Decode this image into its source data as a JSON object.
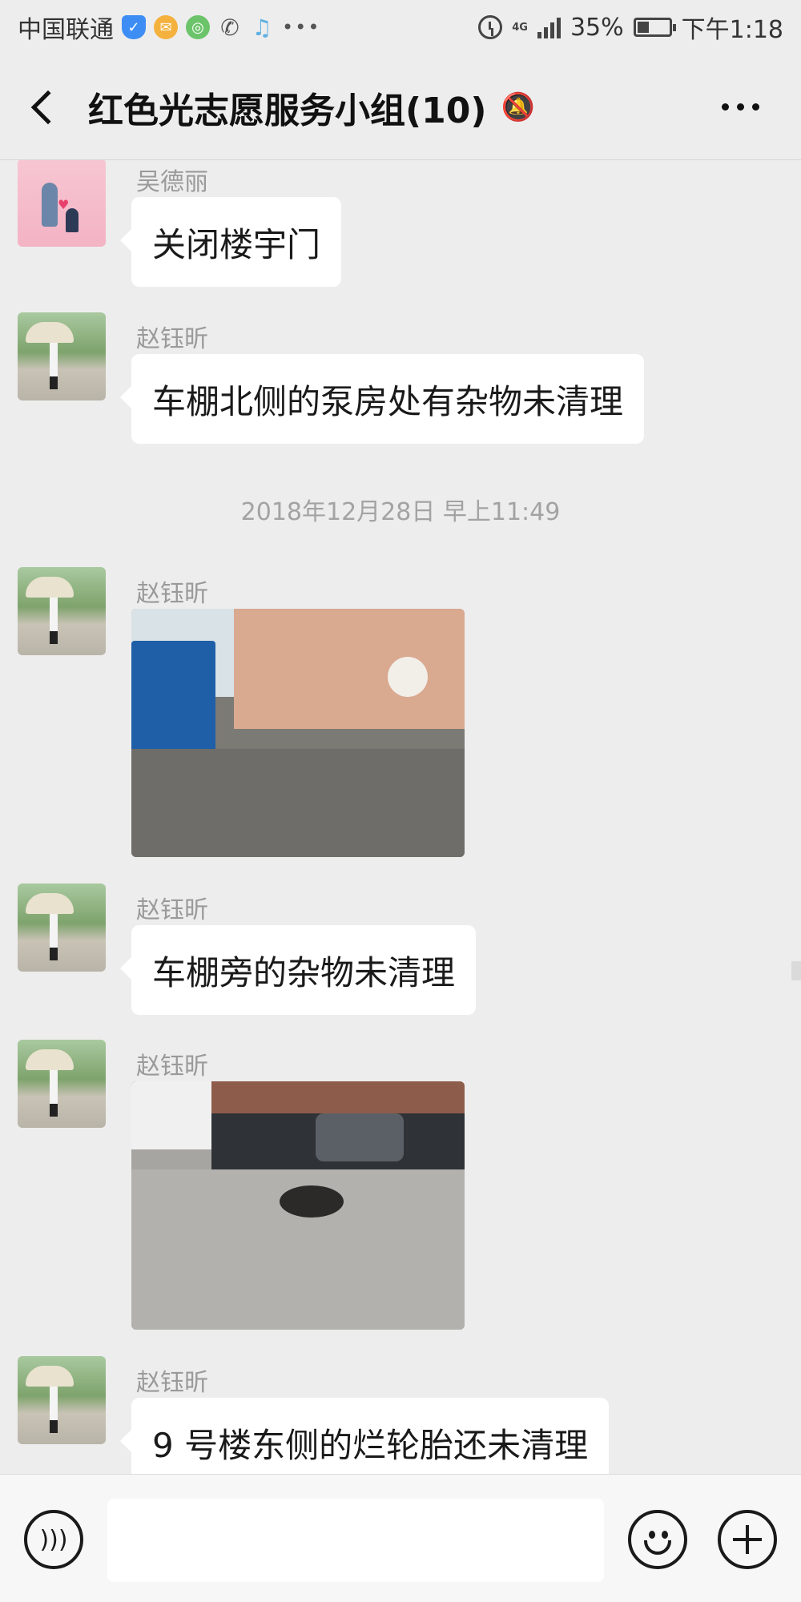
{
  "status_bar": {
    "carrier": "中国联通",
    "network": "4G",
    "battery": "35%",
    "time": "下午1:18",
    "icons": [
      "shield-icon",
      "mail-icon",
      "app-icon",
      "wechat-icon",
      "bell-icon",
      "more-dots-icon",
      "alarm-icon",
      "signal-icon",
      "battery-icon"
    ]
  },
  "header": {
    "title": "红色光志愿服务小组(10)",
    "muted": true
  },
  "messages": [
    {
      "type": "text",
      "sender": "吴德丽",
      "avatar": "pink-avatar",
      "text": "关闭楼宇门"
    },
    {
      "type": "text",
      "sender": "赵钰昕",
      "avatar": "umbrella-avatar",
      "text": "车棚北侧的泵房处有杂物未清理"
    },
    {
      "type": "timestamp",
      "text": "2018年12月28日 早上11:49"
    },
    {
      "type": "image",
      "sender": "赵钰昕",
      "avatar": "umbrella-avatar",
      "description": "truck-yard-photo"
    },
    {
      "type": "text",
      "sender": "赵钰昕",
      "avatar": "umbrella-avatar",
      "text": "车棚旁的杂物未清理"
    },
    {
      "type": "image",
      "sender": "赵钰昕",
      "avatar": "umbrella-avatar",
      "description": "tire-gravel-photo"
    },
    {
      "type": "text",
      "sender": "赵钰昕",
      "avatar": "umbrella-avatar",
      "text": "9 号楼东侧的烂轮胎还未清理"
    }
  ],
  "input": {
    "value": "",
    "placeholder": ""
  },
  "colors": {
    "background": "#ededed",
    "bubble": "#ffffff",
    "sender_name": "#9a9a9a"
  }
}
